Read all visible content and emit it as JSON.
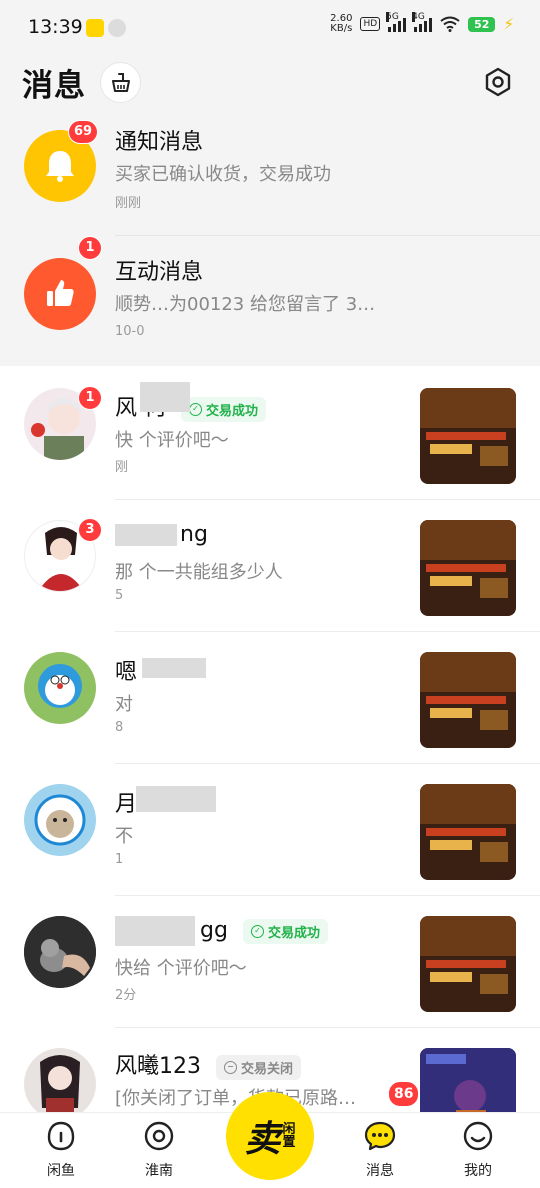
{
  "status_bar": {
    "time": "13:39",
    "net_speed_value": "2.60",
    "net_speed_unit": "KB/s",
    "hd_label": "HD",
    "sig1_label": "5G",
    "sig2_label": "4G",
    "battery": "52"
  },
  "header": {
    "title": "消息"
  },
  "system_items": [
    {
      "title": "通知消息",
      "preview": "买家已确认收货，交易成功",
      "time": "刚刚",
      "badge": "69"
    },
    {
      "title": "互动消息",
      "preview": "顺势…为00123 给您留言了 3…",
      "time": "10-0",
      "badge": "1"
    }
  ],
  "chats": [
    {
      "name": "风 何",
      "preview": "快 个评价吧～",
      "time": "刚",
      "badge": "1",
      "status": "交易成功",
      "status_type": "green"
    },
    {
      "name": "ng",
      "preview": "那 个一共能组多少人",
      "time": "5",
      "badge": "3",
      "status": "",
      "status_type": ""
    },
    {
      "name": "嗯",
      "preview": "对",
      "time": "8",
      "badge": "",
      "status": "",
      "status_type": ""
    },
    {
      "name": "月 4 730",
      "preview": "不",
      "time": "1",
      "badge": "",
      "status": "",
      "status_type": ""
    },
    {
      "name": "gg",
      "preview": "快给 个评价吧～",
      "time": "2分",
      "badge": "",
      "status": "交易成功",
      "status_type": "green"
    },
    {
      "name": "风曦123",
      "preview": "[你关闭了订单，货款已原路…",
      "time": "",
      "badge": "",
      "status": "交易关闭",
      "status_type": "gray"
    }
  ],
  "tabbar": {
    "tabs": [
      {
        "label": "闲鱼"
      },
      {
        "label": "淮南"
      },
      {
        "label": "消息",
        "badge": "86"
      },
      {
        "label": "我的"
      }
    ],
    "sell_main": "卖",
    "sell_sub_1": "闲",
    "sell_sub_2": "置"
  },
  "colors": {
    "accent_yellow": "#ffe000",
    "badge_red": "#ff3b3b",
    "success_green": "#21b24a"
  }
}
